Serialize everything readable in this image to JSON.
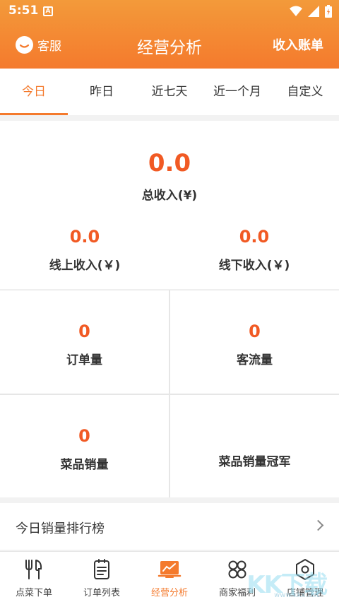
{
  "status": {
    "time": "5:51",
    "notif": "A"
  },
  "header": {
    "service_label": "客服",
    "title": "经营分析",
    "bill_label": "收入账单"
  },
  "tabs": [
    {
      "label": "今日",
      "active": true
    },
    {
      "label": "昨日",
      "active": false
    },
    {
      "label": "近七天",
      "active": false
    },
    {
      "label": "近一个月",
      "active": false
    },
    {
      "label": "自定义",
      "active": false
    }
  ],
  "summary": {
    "total_value": "0.0",
    "total_label": "总收入(¥)",
    "online_value": "0.0",
    "online_label": "线上收入(￥)",
    "offline_value": "0.0",
    "offline_label": "线下收入(￥)"
  },
  "grid": {
    "orders_value": "0",
    "orders_label": "订单量",
    "traffic_value": "0",
    "traffic_label": "客流量",
    "dish_sales_value": "0",
    "dish_sales_label": "菜品销量",
    "champion_label": "菜品销量冠军"
  },
  "ranking": {
    "label": "今日销量排行榜"
  },
  "nav": [
    {
      "label": "点菜下单",
      "icon": "fork-knife-icon"
    },
    {
      "label": "订单列表",
      "icon": "clipboard-icon"
    },
    {
      "label": "经营分析",
      "icon": "chart-board-icon",
      "active": true
    },
    {
      "label": "商家福利",
      "icon": "clover-icon"
    },
    {
      "label": "店铺管理",
      "icon": "gear-hex-icon"
    }
  ],
  "colors": {
    "accent": "#f47a2d",
    "value": "#f15a24"
  },
  "watermark": {
    "main": "KK下载",
    "sub": "www.kkx.net"
  }
}
